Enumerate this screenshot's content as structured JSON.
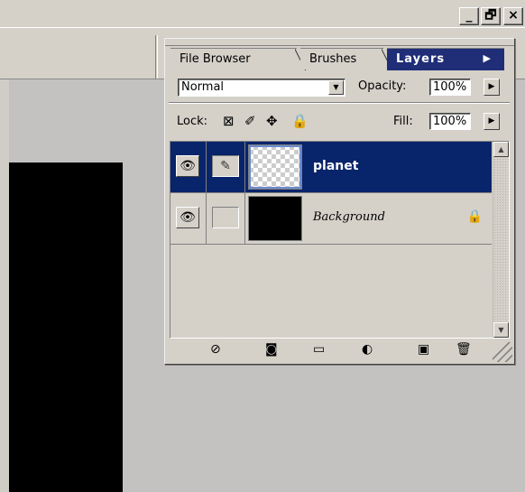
{
  "window": {
    "minimize_label": "_",
    "restore_label": "🗗",
    "close_label": "×"
  },
  "palette": {
    "tabs": [
      {
        "label": "File Browser"
      },
      {
        "label": "Brushes"
      },
      {
        "label": "Layers",
        "active": true
      }
    ],
    "tab_menu_arrow": "▶",
    "blend_mode": "Normal",
    "opacity_label": "Opacity:",
    "opacity_value": "100%",
    "lock_label": "Lock:",
    "fill_label": "Fill:",
    "fill_value": "100%",
    "layers": [
      {
        "name": "planet",
        "selected": true,
        "thumbnail": "transparent-checker"
      },
      {
        "name": "Background",
        "selected": false,
        "thumbnail": "black",
        "locked": true
      }
    ],
    "icons": {
      "eye": "eye-icon",
      "brush": "brush-icon",
      "lock": "lock-icon",
      "lock_transparent": "lock-transparent-icon",
      "lock_paint": "lock-paint-icon",
      "lock_move": "lock-move-icon",
      "layer_style": "layer-style-icon",
      "layer_mask": "layer-mask-icon",
      "new_set": "folder-icon",
      "adjustment": "adjustment-layer-icon",
      "new_layer": "new-layer-icon",
      "trash": "trash-icon"
    }
  },
  "colors": {
    "selection": "#08246b",
    "active_tab": "#1f2e77",
    "panel": "#d5d1c9",
    "workspace": "#c4c1c1"
  }
}
